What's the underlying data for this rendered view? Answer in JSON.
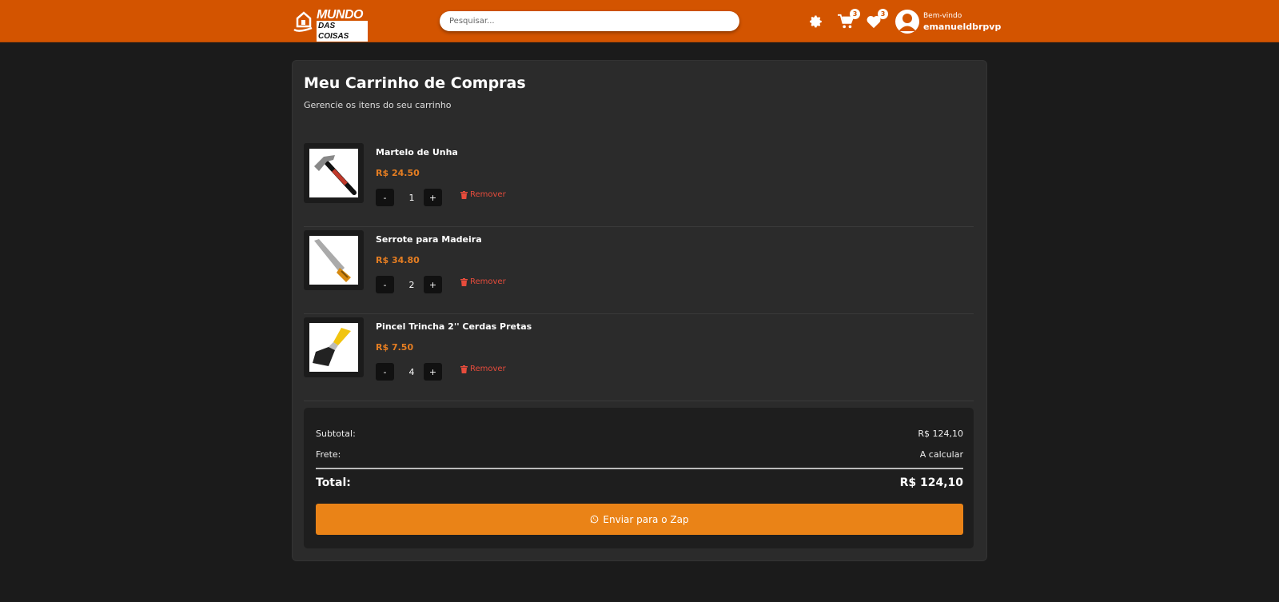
{
  "header": {
    "logo_line1": "MUNDO",
    "logo_line2": "DAS COISAS",
    "search_placeholder": "Pesquisar...",
    "cart_count": "3",
    "favorites_count": "3",
    "welcome": "Bem-vindo",
    "username": "emanueldbrpvp",
    "accent_color": "#d35400"
  },
  "cart": {
    "title": "Meu Carrinho de Compras",
    "subtitle": "Gerencie os itens do seu carrinho",
    "items": [
      {
        "name": "Martelo de Unha",
        "price": "R$ 24.50",
        "qty": "1",
        "minus": "-",
        "plus": "+",
        "remove": "Remover",
        "icon": "hammer-image"
      },
      {
        "name": "Serrote para Madeira",
        "price": "R$ 34.80",
        "qty": "2",
        "minus": "-",
        "plus": "+",
        "remove": "Remover",
        "icon": "saw-image"
      },
      {
        "name": "Pincel Trincha 2'' Cerdas Pretas",
        "price": "R$ 7.50",
        "qty": "4",
        "minus": "-",
        "plus": "+",
        "remove": "Remover",
        "icon": "brush-image"
      }
    ]
  },
  "summary": {
    "subtotal_label": "Subtotal:",
    "subtotal_value": "R$ 124,10",
    "shipping_label": "Frete:",
    "shipping_value": "A calcular",
    "total_label": "Total:",
    "total_value": "R$ 124,10",
    "send_button": "Enviar para o Zap",
    "button_color": "#ea8317"
  }
}
